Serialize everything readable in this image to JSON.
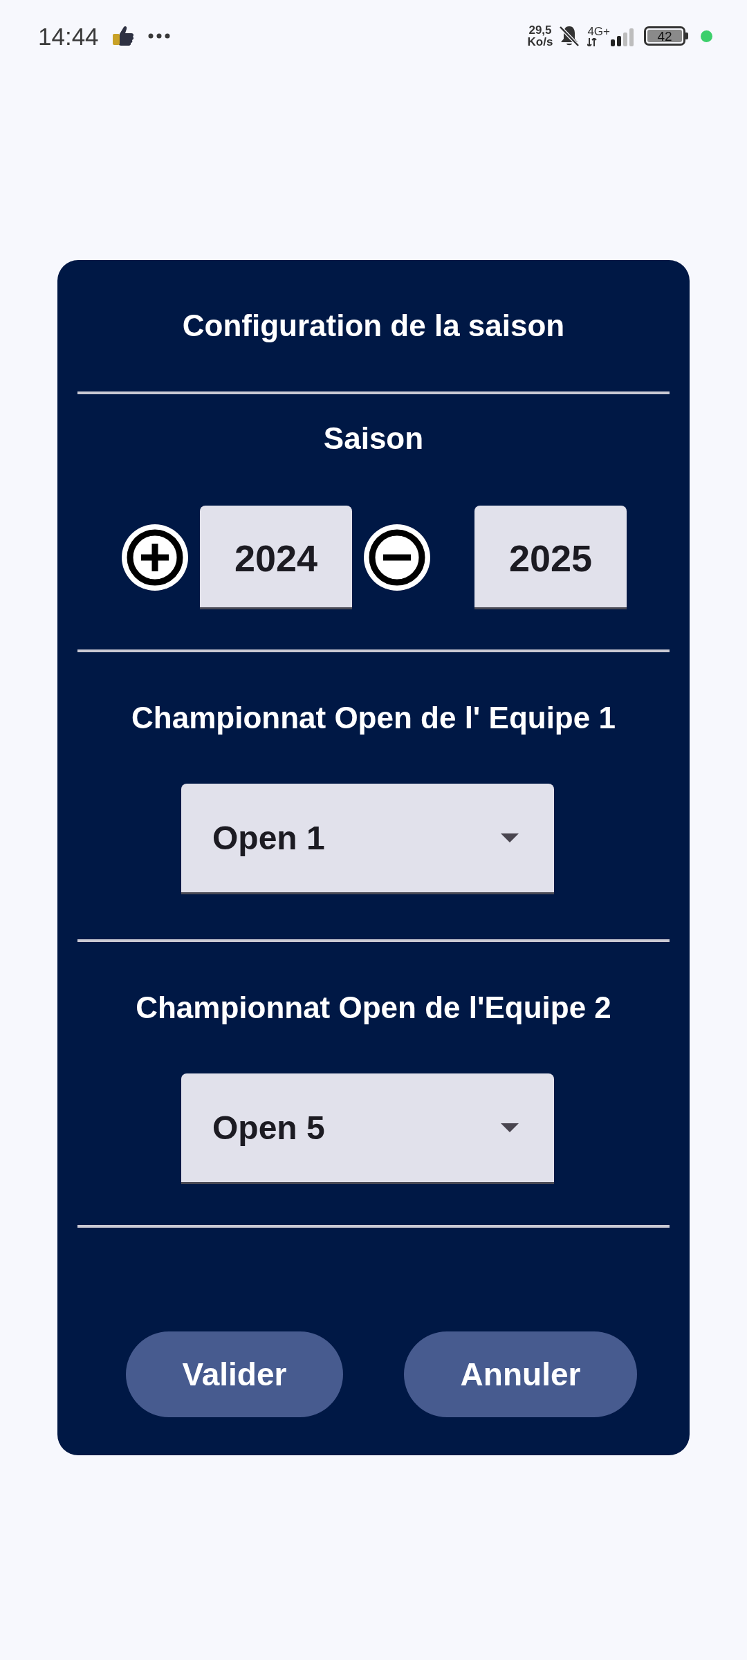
{
  "status_bar": {
    "time": "14:44",
    "network_speed": {
      "value": "29,5",
      "unit": "Ko/s"
    },
    "network_type": "4G+",
    "battery": "42"
  },
  "dialog": {
    "title": "Configuration de la saison",
    "season": {
      "label": "Saison",
      "start_year": "2024",
      "end_year": "2025"
    },
    "championships": [
      {
        "label": "Championnat Open de l' Equipe 1",
        "value": "Open 1"
      },
      {
        "label": "Championnat Open de l'Equipe 2",
        "value": "Open 5"
      }
    ],
    "buttons": [
      {
        "label": "Valider"
      },
      {
        "label": "Annuler"
      }
    ]
  }
}
